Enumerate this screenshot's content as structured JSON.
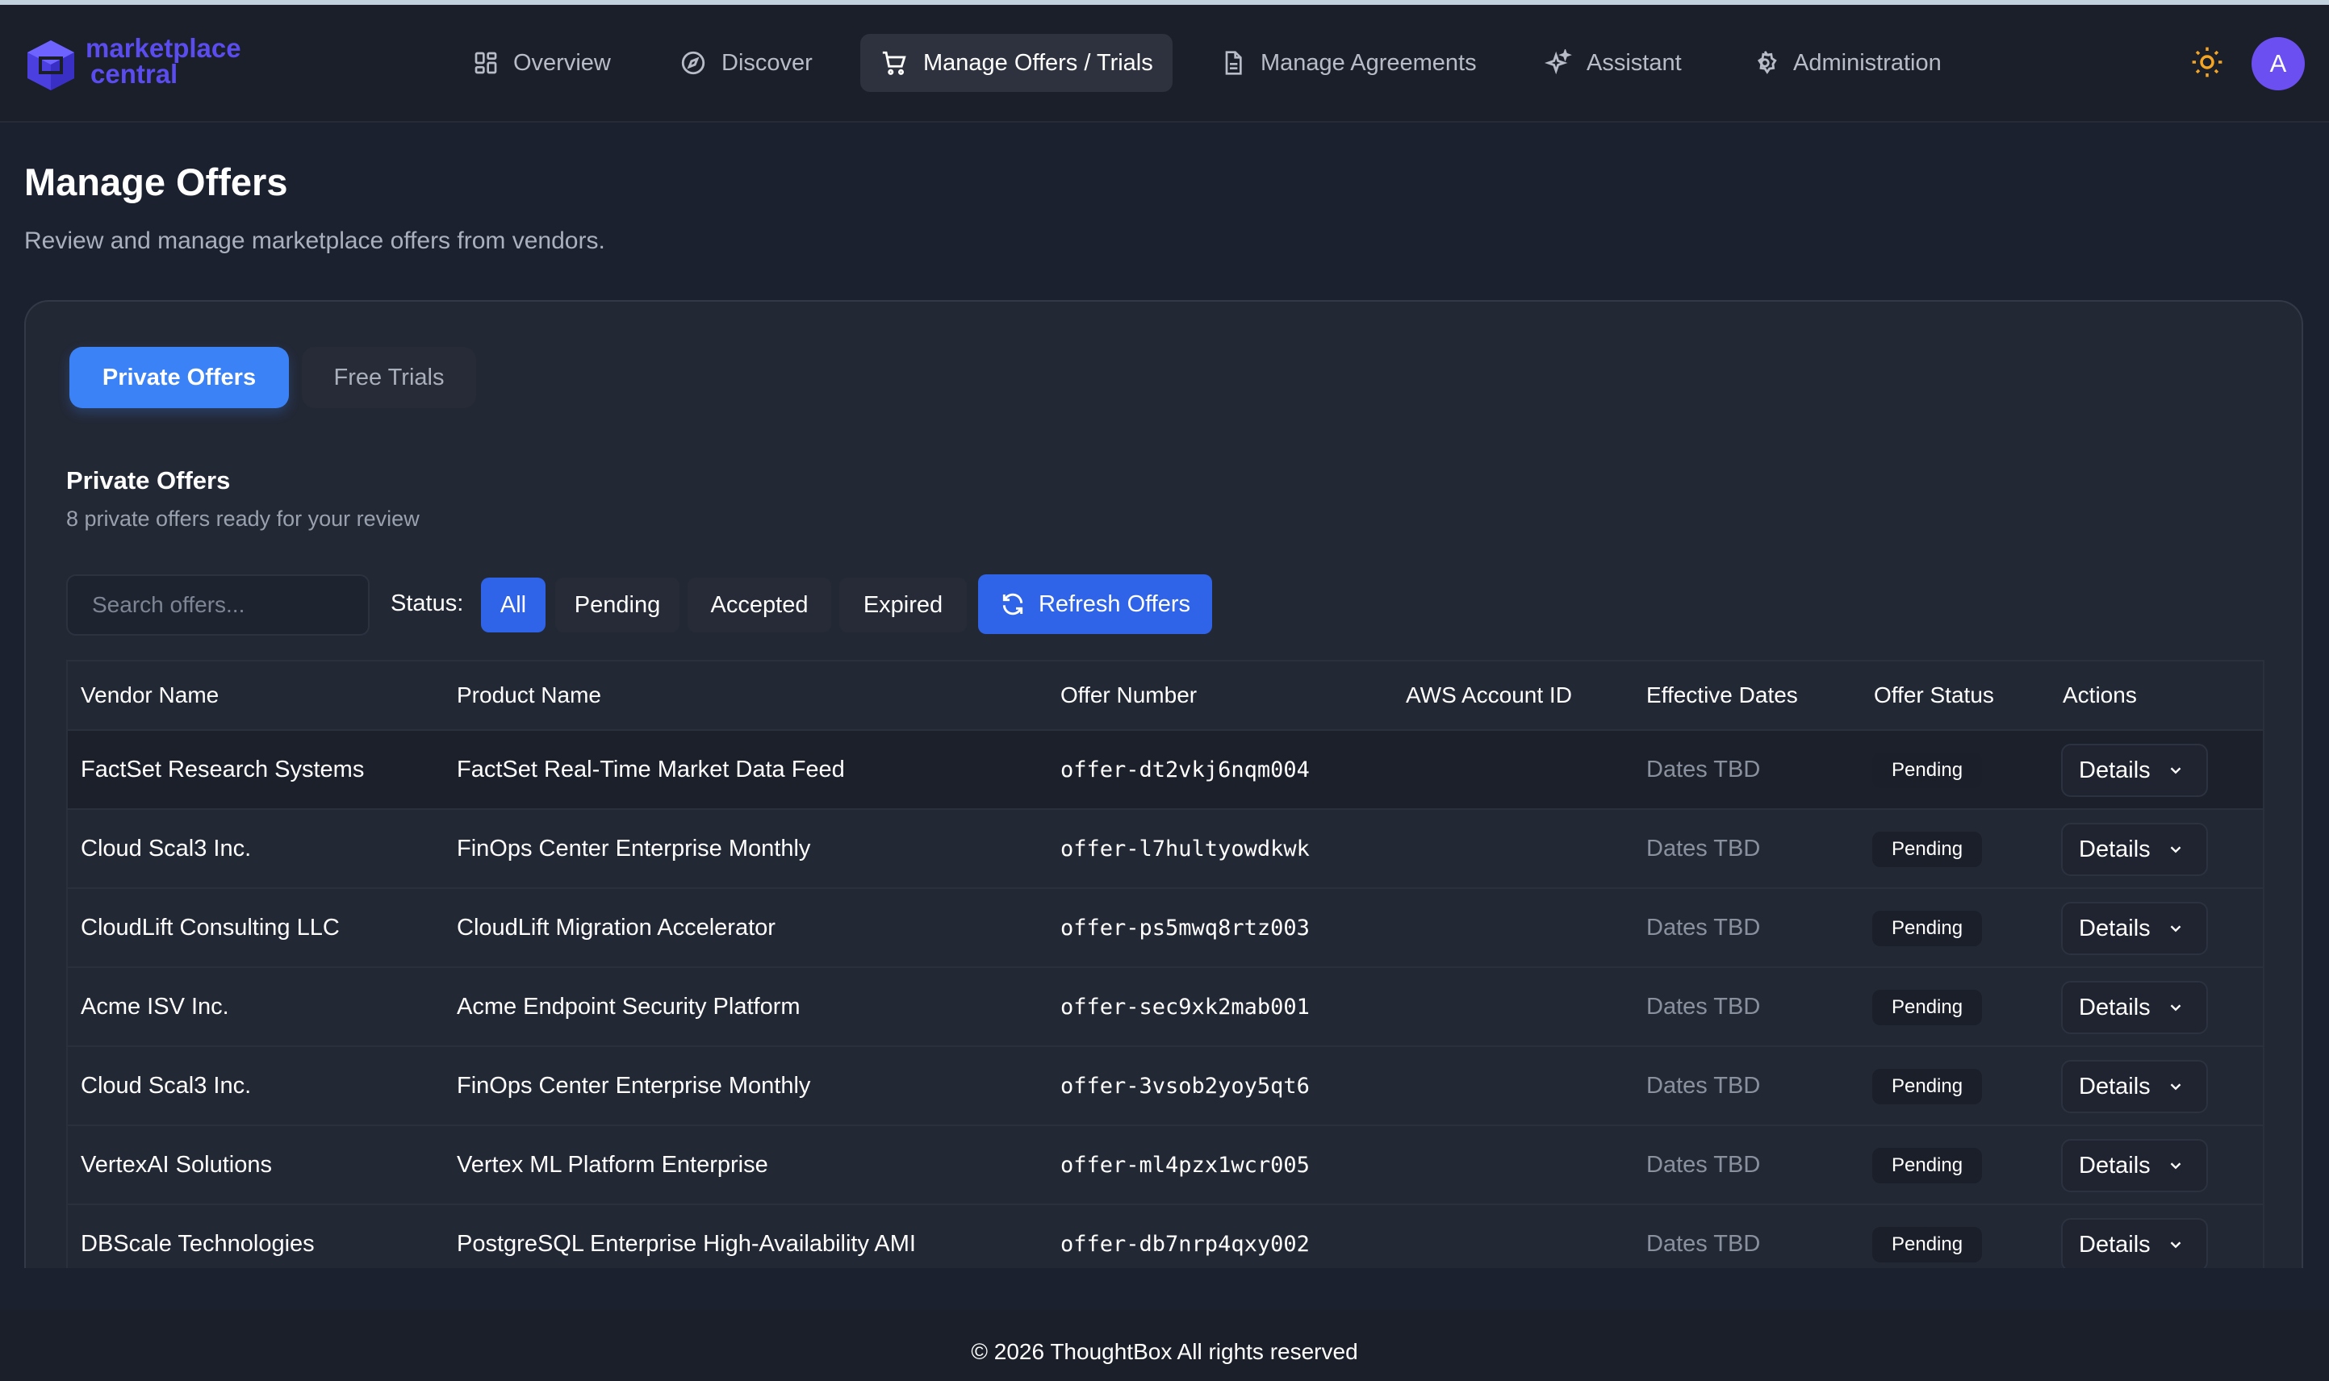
{
  "brand": {
    "line1": "marketplace",
    "line2": "central",
    "color": "#5b4cf0"
  },
  "nav": [
    {
      "label": "Overview",
      "icon": "grid-icon",
      "active": false
    },
    {
      "label": "Discover",
      "icon": "compass-icon",
      "active": false
    },
    {
      "label": "Manage Offers / Trials",
      "icon": "cart-icon",
      "active": true
    },
    {
      "label": "Manage Agreements",
      "icon": "document-icon",
      "active": false
    },
    {
      "label": "Assistant",
      "icon": "sparkles-icon",
      "active": false
    },
    {
      "label": "Administration",
      "icon": "gear-icon",
      "active": false
    }
  ],
  "user": {
    "avatar_initial": "A"
  },
  "page": {
    "title": "Manage Offers",
    "subtitle": "Review and manage marketplace offers from vendors."
  },
  "tabs": {
    "private": "Private Offers",
    "free": "Free Trials"
  },
  "section": {
    "title": "Private Offers",
    "subtitle": "8 private offers ready for your review"
  },
  "search": {
    "placeholder": "Search offers...",
    "value": ""
  },
  "filters": {
    "label": "Status:",
    "options": [
      "All",
      "Pending",
      "Accepted",
      "Expired"
    ],
    "selected": "All"
  },
  "refresh_label": "Refresh Offers",
  "table": {
    "columns": [
      "Vendor Name",
      "Product Name",
      "Offer Number",
      "AWS Account ID",
      "Effective Dates",
      "Offer Status",
      "Actions"
    ],
    "rows": [
      {
        "vendor": "FactSet Research Systems",
        "product": "FactSet Real-Time Market Data Feed",
        "offer": "offer-dt2vkj6nqm004",
        "account": "",
        "dates": "Dates TBD",
        "status": "Pending",
        "action": "Details"
      },
      {
        "vendor": "Cloud Scal3 Inc.",
        "product": "FinOps Center Enterprise Monthly",
        "offer": "offer-l7hultyowdkwk",
        "account": "",
        "dates": "Dates TBD",
        "status": "Pending",
        "action": "Details"
      },
      {
        "vendor": "CloudLift Consulting LLC",
        "product": "CloudLift Migration Accelerator",
        "offer": "offer-ps5mwq8rtz003",
        "account": "",
        "dates": "Dates TBD",
        "status": "Pending",
        "action": "Details"
      },
      {
        "vendor": "Acme ISV Inc.",
        "product": "Acme Endpoint Security Platform",
        "offer": "offer-sec9xk2mab001",
        "account": "",
        "dates": "Dates TBD",
        "status": "Pending",
        "action": "Details"
      },
      {
        "vendor": "Cloud Scal3 Inc.",
        "product": "FinOps Center Enterprise Monthly",
        "offer": "offer-3vsob2yoy5qt6",
        "account": "",
        "dates": "Dates TBD",
        "status": "Pending",
        "action": "Details"
      },
      {
        "vendor": "VertexAI Solutions",
        "product": "Vertex ML Platform Enterprise",
        "offer": "offer-ml4pzx1wcr005",
        "account": "",
        "dates": "Dates TBD",
        "status": "Pending",
        "action": "Details"
      },
      {
        "vendor": "DBScale Technologies",
        "product": "PostgreSQL Enterprise High-Availability AMI",
        "offer": "offer-db7nrp4qxy002",
        "account": "",
        "dates": "Dates TBD",
        "status": "Pending",
        "action": "Details"
      }
    ]
  },
  "footer": "© 2026 ThoughtBox All rights reserved",
  "colors": {
    "accent": "#3b82f6",
    "background": "#1c2130",
    "sun": "#f5a524",
    "avatar": "#6b4ff0"
  }
}
